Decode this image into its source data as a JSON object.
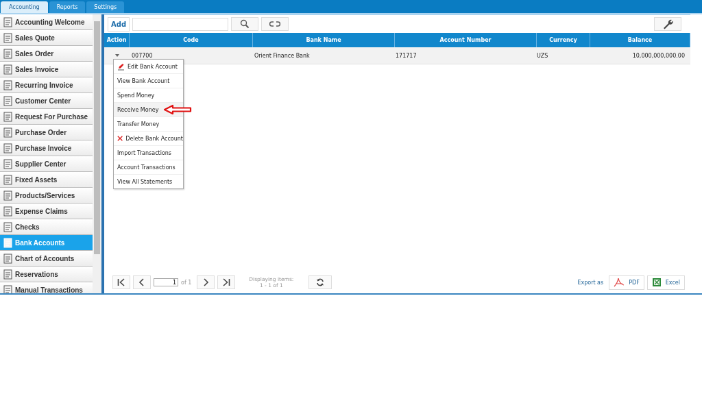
{
  "tabs": [
    {
      "label": "Accounting",
      "selected": true
    },
    {
      "label": "Reports",
      "selected": false
    },
    {
      "label": "Settings",
      "selected": false
    }
  ],
  "sidebar": {
    "items": [
      {
        "label": "Accounting Welcome",
        "selected": false
      },
      {
        "label": "Sales Quote",
        "selected": false
      },
      {
        "label": "Sales Order",
        "selected": false
      },
      {
        "label": "Sales Invoice",
        "selected": false
      },
      {
        "label": "Recurring Invoice",
        "selected": false
      },
      {
        "label": "Customer Center",
        "selected": false
      },
      {
        "label": "Request For Purchase",
        "selected": false
      },
      {
        "label": "Purchase Order",
        "selected": false
      },
      {
        "label": "Purchase Invoice",
        "selected": false
      },
      {
        "label": "Supplier Center",
        "selected": false
      },
      {
        "label": "Fixed Assets",
        "selected": false
      },
      {
        "label": "Products/Services",
        "selected": false
      },
      {
        "label": "Expense Claims",
        "selected": false
      },
      {
        "label": "Checks",
        "selected": false
      },
      {
        "label": "Bank Accounts",
        "selected": true
      },
      {
        "label": "Chart of Accounts",
        "selected": false
      },
      {
        "label": "Reservations",
        "selected": false
      },
      {
        "label": "Manual Transactions",
        "selected": false
      }
    ]
  },
  "toolbar": {
    "add": "Add"
  },
  "table": {
    "columns": [
      "Action",
      "Code",
      "Bank Name",
      "Account Number",
      "Currency",
      "Balance"
    ],
    "rows": [
      {
        "code": "007700",
        "bank_name": "Orient Finance Bank",
        "account_number": "171717",
        "currency": "UZS",
        "balance": "10,000,000,000.00"
      }
    ]
  },
  "action_menu": {
    "items": [
      {
        "label": "Edit Bank Account",
        "kind": "edit",
        "highlighted": false
      },
      {
        "label": "View Bank Account",
        "kind": "plain",
        "highlighted": false
      },
      {
        "label": "Spend Money",
        "kind": "plain",
        "highlighted": false
      },
      {
        "label": "Receive Money",
        "kind": "plain",
        "highlighted": true
      },
      {
        "label": "Transfer Money",
        "kind": "plain",
        "highlighted": false
      },
      {
        "label": "Delete Bank Account",
        "kind": "delete",
        "highlighted": false
      },
      {
        "label": "Import Transactions",
        "kind": "plain",
        "highlighted": false
      },
      {
        "label": "Account Transactions",
        "kind": "plain",
        "highlighted": false
      },
      {
        "label": "View All Statements",
        "kind": "plain",
        "highlighted": false
      }
    ]
  },
  "pager": {
    "page": "1",
    "of": "of 1",
    "display_label": "Displaying items:",
    "display_range": "1 - 1 of 1"
  },
  "export": {
    "label": "Export as",
    "pdf": "PDF",
    "excel": "Excel"
  }
}
